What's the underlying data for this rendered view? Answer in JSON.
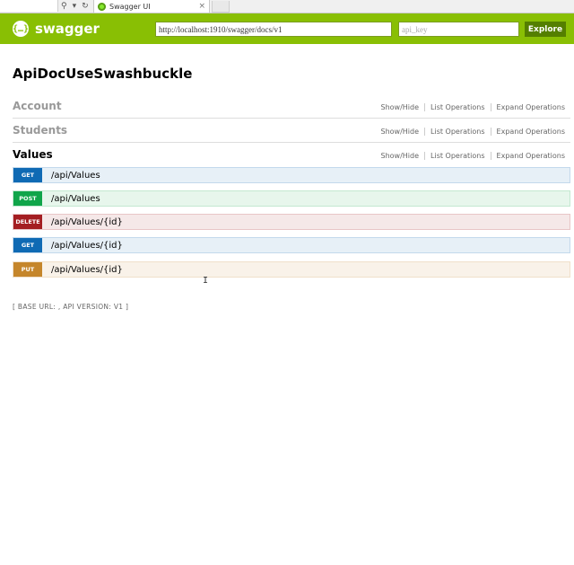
{
  "browser": {
    "nav_icons": [
      "⚲",
      "▾",
      "↻"
    ],
    "tab_title": "Swagger UI",
    "tab_close": "×"
  },
  "header": {
    "logo_icon": "{…}",
    "logo_text": "swagger",
    "url_value": "http://localhost:1910/swagger/docs/v1",
    "api_key_placeholder": "api_key",
    "explore_label": "Explore",
    "brand_color": "#89bf04"
  },
  "page": {
    "title": "ApiDocUseSwashbuckle"
  },
  "resources": [
    {
      "name": "Account",
      "links": [
        "Show/Hide",
        "List Operations",
        "Expand Operations"
      ]
    },
    {
      "name": "Students",
      "links": [
        "Show/Hide",
        "List Operations",
        "Expand Operations"
      ]
    },
    {
      "name": "Values",
      "links": [
        "Show/Hide",
        "List Operations",
        "Expand Operations"
      ]
    }
  ],
  "operations": [
    {
      "method": "GET",
      "path": "/api/Values"
    },
    {
      "method": "POST",
      "path": "/api/Values"
    },
    {
      "method": "DELETE",
      "path": "/api/Values/{id}"
    },
    {
      "method": "GET",
      "path": "/api/Values/{id}"
    },
    {
      "method": "PUT",
      "path": "/api/Values/{id}"
    }
  ],
  "footer": {
    "text": "[ BASE URL: , API VERSION: V1 ]"
  }
}
